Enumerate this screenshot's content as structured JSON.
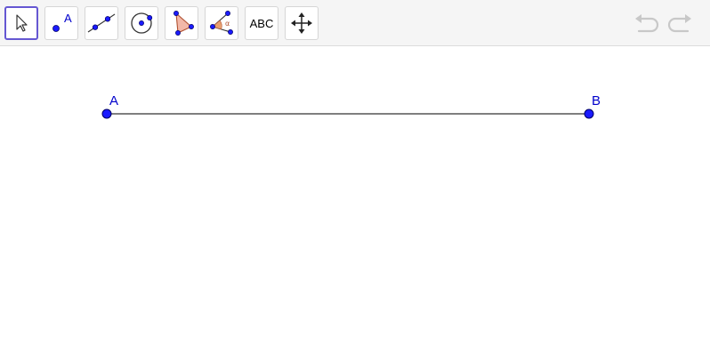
{
  "toolbar": {
    "tools": [
      {
        "name": "move-tool",
        "icon": "pointer-arrow-icon",
        "active": true
      },
      {
        "name": "point-tool",
        "icon": "point-icon",
        "label": "A"
      },
      {
        "name": "line-tool",
        "icon": "line-icon"
      },
      {
        "name": "circle-tool",
        "icon": "circle-icon"
      },
      {
        "name": "polygon-tool",
        "icon": "polygon-icon"
      },
      {
        "name": "angle-tool",
        "icon": "angle-icon",
        "label": "α"
      },
      {
        "name": "text-tool",
        "icon": "text-icon",
        "label": "ABC"
      },
      {
        "name": "move-graphics-view-tool",
        "icon": "move-arrows-icon"
      }
    ],
    "undo_icon": "undo-icon",
    "redo_icon": "redo-icon"
  },
  "construction": {
    "points": [
      {
        "label": "A"
      },
      {
        "label": "B"
      }
    ],
    "segment": {
      "from": "A",
      "to": "B"
    }
  },
  "colors": {
    "accent": "#6557d2",
    "point": "#1a1aff",
    "label": "#0000cc",
    "segment": "#555555",
    "polygon_fill": "#f2b8a8",
    "angle_fill": "#e8a070",
    "disabled": "#c8c8c8"
  }
}
